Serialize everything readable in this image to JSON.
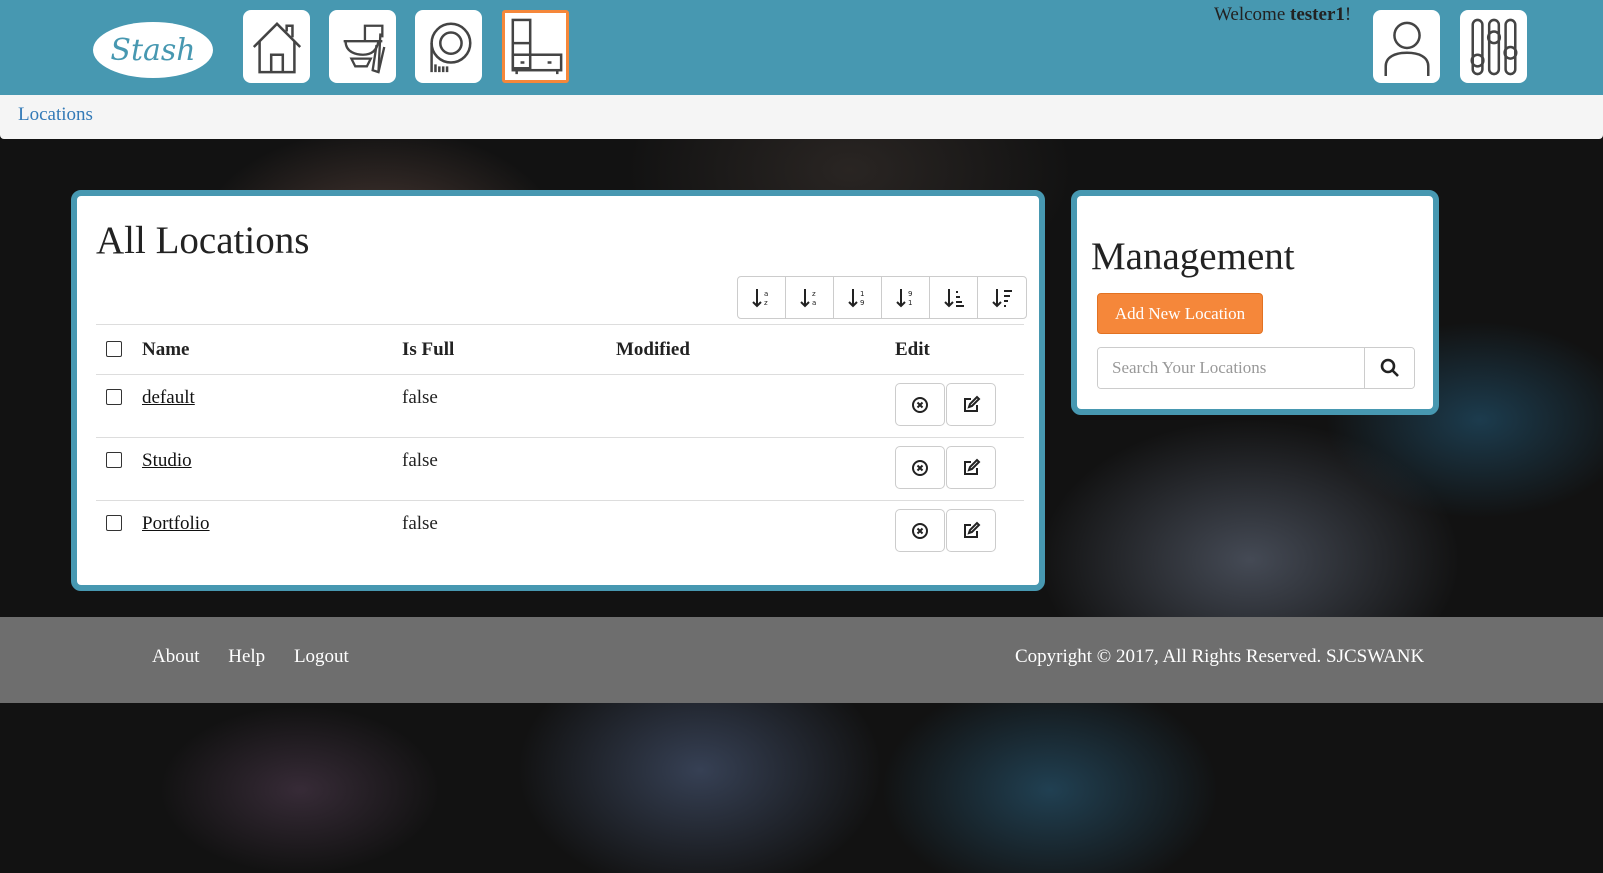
{
  "header": {
    "logo_text": "Stash",
    "nav": [
      {
        "name": "home",
        "icon": "home-icon"
      },
      {
        "name": "supplies",
        "icon": "sewing-machine-icon"
      },
      {
        "name": "patterns",
        "icon": "pattern-icon"
      },
      {
        "name": "locations",
        "icon": "storage-cabinet-icon",
        "active": true
      }
    ],
    "welcome_prefix": "Welcome ",
    "username": "tester1",
    "welcome_suffix": "!",
    "profile_icon": "user-icon",
    "settings_icon": "sliders-icon"
  },
  "breadcrumb": {
    "current": "Locations"
  },
  "main": {
    "title": "All Locations",
    "sort_buttons": [
      "sort-alpha-down-icon",
      "sort-alpha-up-icon",
      "sort-numeric-down-icon",
      "sort-numeric-up-icon",
      "sort-amount-down-icon",
      "sort-amount-up-icon"
    ],
    "columns": {
      "name": "Name",
      "is_full": "Is Full",
      "modified": "Modified",
      "edit": "Edit"
    },
    "rows": [
      {
        "name": "default",
        "is_full": "false",
        "modified": ""
      },
      {
        "name": "Studio",
        "is_full": "false",
        "modified": ""
      },
      {
        "name": "Portfolio",
        "is_full": "false",
        "modified": ""
      }
    ]
  },
  "management": {
    "title": "Management",
    "add_button": "Add New Location",
    "search_placeholder": "Search Your Locations"
  },
  "footer": {
    "links": [
      "About",
      "Help",
      "Logout"
    ],
    "copyright": "Copyright © 2017, All Rights Reserved. SJCSWANK"
  },
  "colors": {
    "brand": "#4798b1",
    "accent": "#f5873a",
    "footer": "#6e6e6e"
  }
}
